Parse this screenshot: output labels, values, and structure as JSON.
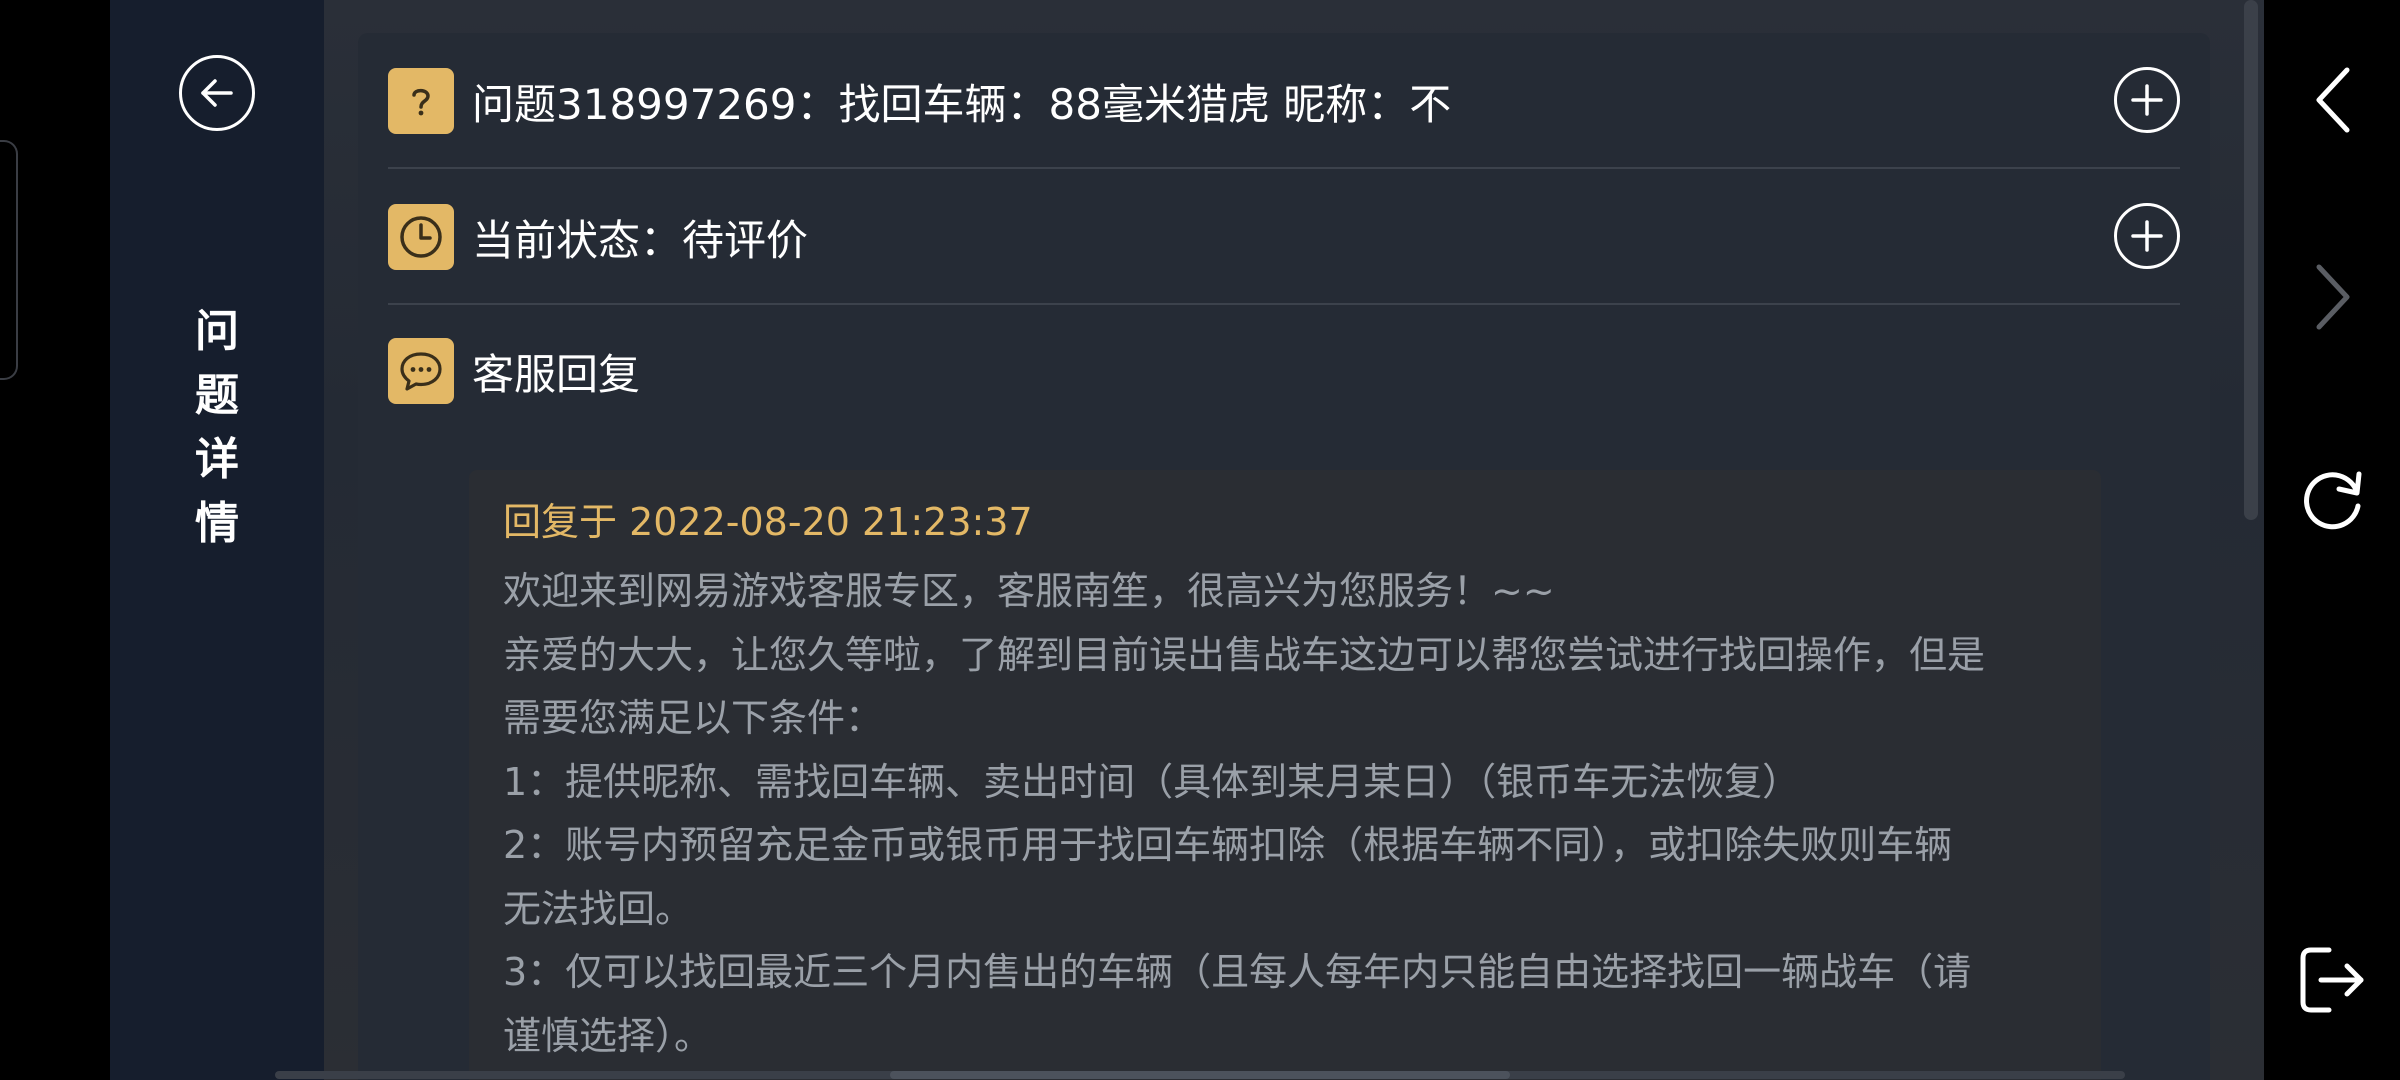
{
  "nav": {
    "title_chars": [
      "问",
      "题",
      "详",
      "情"
    ]
  },
  "rows": {
    "question": "问题318997269：找回车辆：88毫米猎虎 昵称：不",
    "status": "当前状态：待评价",
    "reply_header": "客服回复"
  },
  "reply": {
    "time": "回复于 2022-08-20 21:23:37",
    "lines": [
      "欢迎来到网易游戏客服专区，客服南笙，很高兴为您服务！~~",
      "亲爱的大大，让您久等啦，了解到目前误出售战车这边可以帮您尝试进行找回操作，但是",
      "需要您满足以下条件：",
      "1：提供昵称、需找回车辆、卖出时间（具体到某月某日）（银币车无法恢复）",
      "2：账号内预留充足金币或银币用于找回车辆扣除（根据车辆不同），或扣除失败则车辆",
      "无法找回。",
      "3：仅可以找回最近三个月内售出的车辆（且每人每年内只能自由选择找回一辆战车（请",
      "谨慎选择）。"
    ]
  },
  "icons": {
    "back": "arrow-left-circle-icon",
    "question": "question-mark-icon",
    "status": "clock-icon",
    "reply": "chat-bubble-icon",
    "expand": "plus-circle-icon",
    "browser_back": "chevron-left-icon",
    "browser_forward": "chevron-right-icon",
    "refresh": "refresh-icon",
    "exit": "exit-icon"
  },
  "colors": {
    "accent": "#e3b866",
    "nav_bg": "#161e2d",
    "panel_bg": "#252b35",
    "reply_bg": "#2a2d33",
    "reply_text": "#9aa0a8"
  }
}
